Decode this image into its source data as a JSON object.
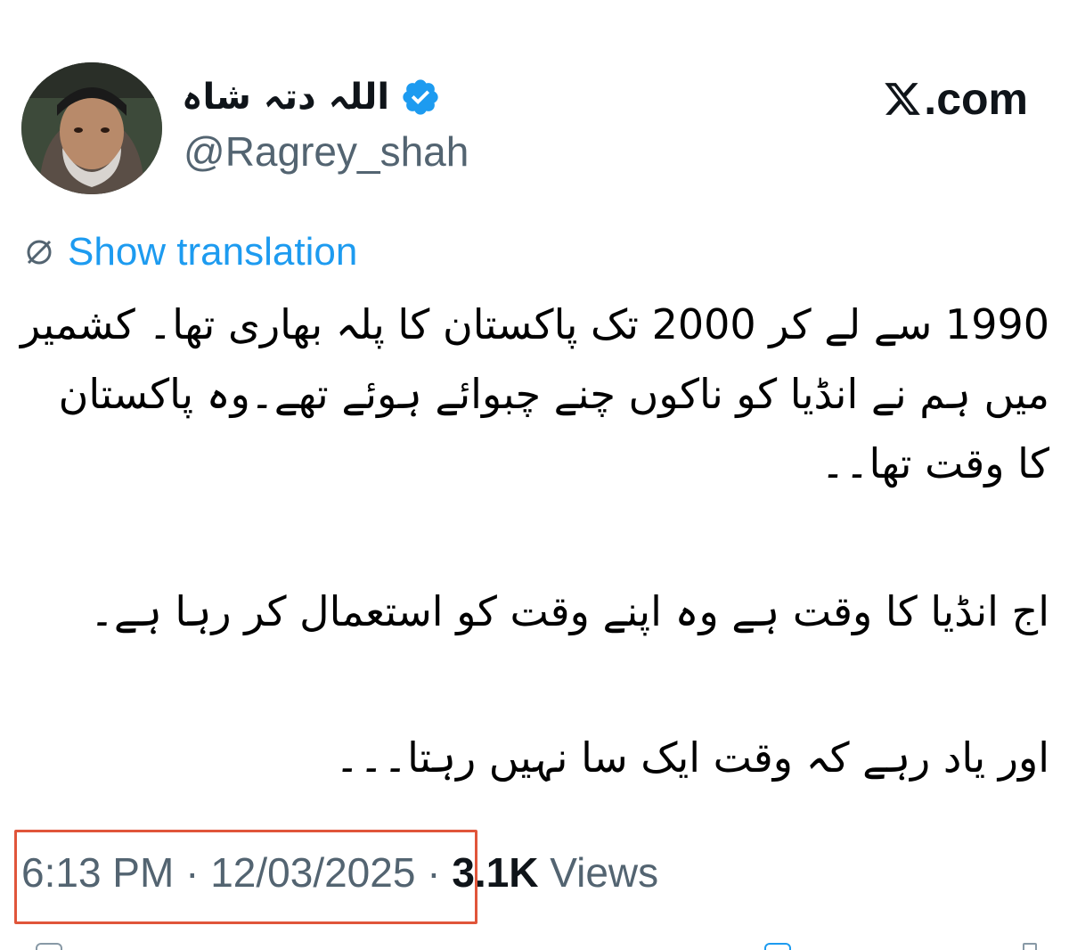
{
  "author": {
    "display_name": "اللہ دتہ شاہ",
    "handle": "@Ragrey_shah",
    "verified": true
  },
  "watermark": {
    "text": ".com",
    "icon": "x-logo-icon"
  },
  "translation": {
    "label": "Show translation",
    "icon": "translate-icon"
  },
  "tweet": {
    "paragraphs": [
      "1990 سے لے کر 2000 تک پاکستان کا پلہ بھاری تھا۔ کشمیر میں ہم نے انڈیا کو ناکوں چنے چبوائے ہوئے تھے۔وہ پاکستان کا وقت تھا۔۔",
      "اج انڈیا کا وقت ہے وہ اپنے وقت کو استعمال کر رہا ہے۔",
      "اور یاد رہے کہ وقت ایک سا نہیں رہتا۔۔۔"
    ]
  },
  "meta": {
    "time": "6:13 PM",
    "separator": " · ",
    "date": "12/03/2025",
    "views_count": "3.1K",
    "views_label": " Views"
  },
  "colors": {
    "link": "#1d9bf0",
    "secondary_text": "#536471",
    "highlight_border": "#e0553a",
    "verified": "#1d9bf0"
  }
}
